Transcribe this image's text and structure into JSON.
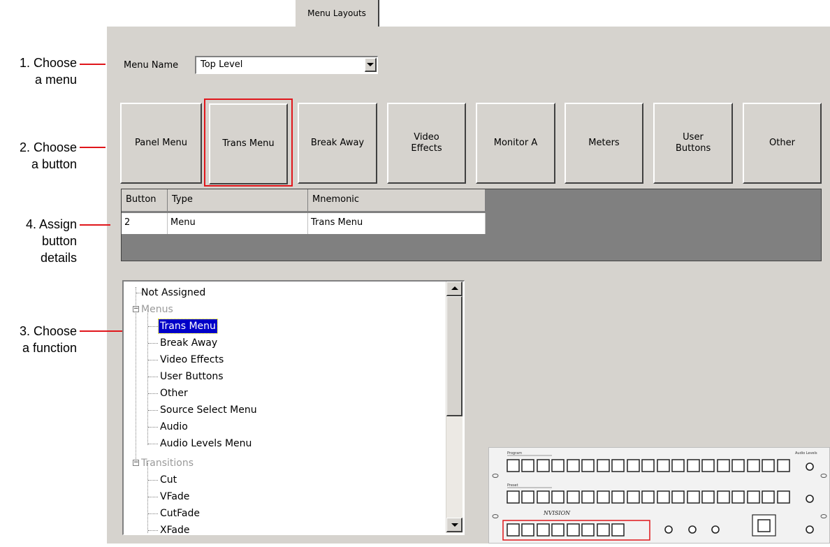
{
  "tab": {
    "label": "Menu Layouts"
  },
  "annotations": {
    "choose_menu": [
      "1. Choose",
      "a menu"
    ],
    "choose_button": [
      "2. Choose",
      "a button"
    ],
    "assign_details": [
      "4. Assign",
      "button",
      "details"
    ],
    "choose_function": [
      "3. Choose",
      "a function"
    ]
  },
  "menu_name": {
    "label": "Menu Name",
    "value": "Top Level"
  },
  "menu_buttons": [
    {
      "label": "Panel Menu"
    },
    {
      "label": "Trans Menu",
      "selected": true
    },
    {
      "label": "Break Away"
    },
    {
      "label": "Video Effects"
    },
    {
      "label": "Monitor A"
    },
    {
      "label": "Meters"
    },
    {
      "label": "User Buttons"
    },
    {
      "label": "Other"
    }
  ],
  "grid": {
    "headers": [
      "Button",
      "Type",
      "Mnemonic"
    ],
    "rows": [
      [
        "2",
        "Menu",
        "Trans Menu"
      ]
    ]
  },
  "tree": {
    "items": [
      {
        "label": "Not Assigned"
      },
      {
        "label": "Menus",
        "group": true
      },
      {
        "label": "Trans Menu",
        "selected": true
      },
      {
        "label": "Break Away"
      },
      {
        "label": "Video Effects"
      },
      {
        "label": "User Buttons"
      },
      {
        "label": "Other"
      },
      {
        "label": "Source Select Menu"
      },
      {
        "label": "Audio"
      },
      {
        "label": "Audio Levels Menu"
      },
      {
        "label": "Transitions",
        "group": true
      },
      {
        "label": "Cut"
      },
      {
        "label": "VFade"
      },
      {
        "label": "CutFade"
      },
      {
        "label": "XFade"
      }
    ]
  },
  "hardware": {
    "logo": "NVISION",
    "program_label": "Program",
    "preset_label": "Preset",
    "audio_levels_label": "Audio Levels"
  },
  "colors": {
    "annotation": "#e0161b",
    "panel": "#d6d3ce",
    "selection": "#0000c8"
  }
}
